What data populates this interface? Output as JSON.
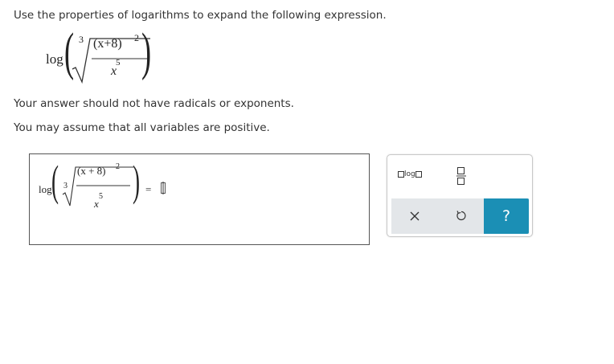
{
  "instruction": "Use the properties of logarithms to expand the following expression.",
  "question": {
    "log": "log",
    "root_index": "3",
    "numerator": "(x+8)",
    "numerator_exponent": "2",
    "denominator": "x",
    "denominator_exponent": "5"
  },
  "note1": "Your answer should not have radicals or exponents.",
  "note2": "You may assume that all variables are positive.",
  "answer": {
    "log": "log",
    "root_index": "3",
    "numerator": "(x + 8)",
    "numerator_exponent": "2",
    "denominator": "x",
    "denominator_exponent": "5",
    "equals": "="
  },
  "palette": {
    "log_label": "log",
    "help_label": "?",
    "clear_label": "✕",
    "reset_label": "↺"
  },
  "colors": {
    "accent": "#1b8fb5",
    "toolbar_bg": "#e3e6e9"
  }
}
